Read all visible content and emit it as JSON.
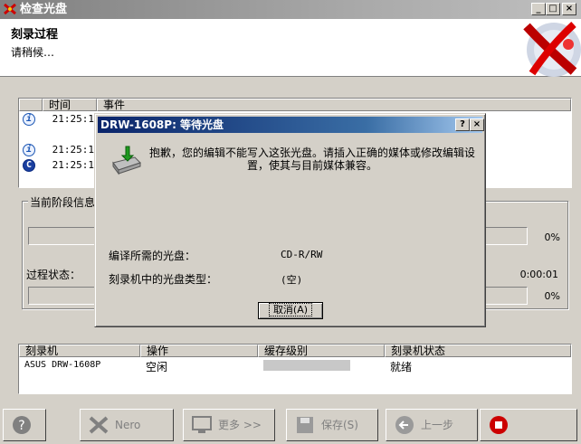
{
  "window": {
    "title": "检查光盘",
    "min": "_",
    "max": "□",
    "close": "×"
  },
  "header": {
    "title": "刻录过程",
    "subtitle": "请稍候…"
  },
  "log": {
    "columns": [
      "时间",
      "事件"
    ],
    "rows": [
      {
        "time": "21:25:17",
        "icon": "info-icon"
      },
      {
        "time": "21:25:17",
        "icon": "info-icon"
      },
      {
        "time": "21:25:17",
        "icon": "copyright-icon"
      }
    ]
  },
  "stage": {
    "legend": "当前阶段信息",
    "progress1": "0%",
    "status_label": "过程状态：",
    "elapsed": "0:00:01",
    "progress2": "0%"
  },
  "recorders": {
    "columns": [
      "刻录机",
      "操作",
      "缓存级别",
      "刻录机状态"
    ],
    "rows": [
      {
        "name": "ASUS DRW-1608P",
        "operation": "空闲",
        "buffer": 0,
        "status": "就绪"
      }
    ]
  },
  "toolbar": {
    "nero": "Nero",
    "more": "更多 >>",
    "save": "保存(S)",
    "back": "上一步"
  },
  "dialog": {
    "title": "DRW-1608P: 等待光盘",
    "help": "?",
    "close": "×",
    "message": "抱歉，您的编辑不能写入这张光盘。请插入正确的媒体或修改编辑设置，使其与目前媒体兼容。",
    "required_label": "编译所需的光盘：",
    "required_value": "CD-R/RW",
    "current_label": "刻录机中的光盘类型：",
    "current_value": "(空)",
    "cancel": "取消(A)"
  }
}
